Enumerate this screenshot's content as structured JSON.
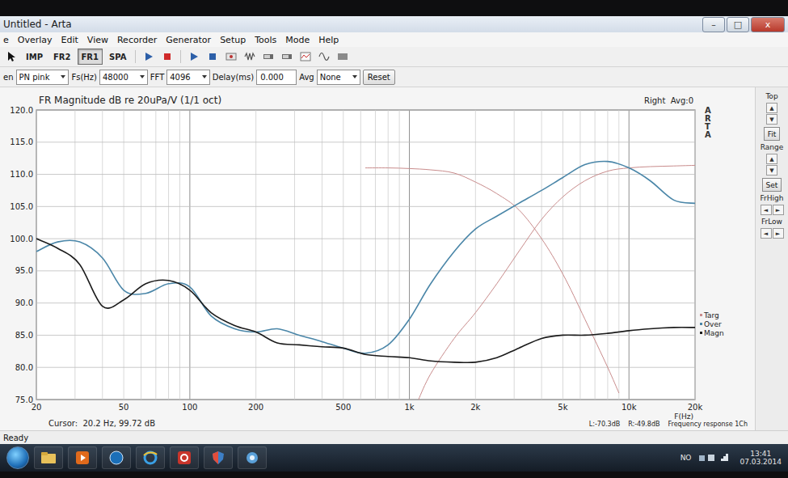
{
  "window": {
    "title": "Untitled - Arta",
    "controls": [
      "–",
      "□",
      "x"
    ]
  },
  "menu": [
    "e",
    "Overlay",
    "Edit",
    "View",
    "Recorder",
    "Generator",
    "Setup",
    "Tools",
    "Mode",
    "Help"
  ],
  "mode_buttons": [
    {
      "label": "IMP",
      "selected": false
    },
    {
      "label": "FR2",
      "selected": false
    },
    {
      "label": "FR1",
      "selected": true
    },
    {
      "label": "SPA",
      "selected": false
    }
  ],
  "generator_bar": [
    {
      "kind": "label",
      "text": "en"
    },
    {
      "kind": "select",
      "text": "PN pink"
    },
    {
      "kind": "label",
      "text": "Fs(Hz)"
    },
    {
      "kind": "select",
      "text": "48000"
    },
    {
      "kind": "label",
      "text": "FFT"
    },
    {
      "kind": "select",
      "text": "4096"
    },
    {
      "kind": "label",
      "text": "Delay(ms)"
    },
    {
      "kind": "input",
      "text": "0.000"
    },
    {
      "kind": "label",
      "text": "Avg"
    },
    {
      "kind": "select",
      "text": "None"
    },
    {
      "kind": "button",
      "text": "Reset"
    }
  ],
  "chart": {
    "title": "FR Magnitude dB re 20uPa/V (1/1 oct)",
    "channel": "Right  Avg:0",
    "watermark": "ARTA",
    "y_ticks": [
      "120.0",
      "115.0",
      "110.0",
      "105.0",
      "100.0",
      "95.0",
      "90.0",
      "85.0",
      "80.0",
      "75.0"
    ],
    "x_ticks": [
      "20",
      "50",
      "100",
      "200",
      "500",
      "1k",
      "2k",
      "5k",
      "10k",
      "20k"
    ],
    "x_axis_label": "F(Hz)",
    "cursor": "Cursor:  20.2 Hz, 99.72 dB",
    "readouts": [
      "L:-70.3dB",
      "R:-49.8dB",
      "Frequency response 1Ch"
    ],
    "series": [
      {
        "name": "Targ",
        "color": "#c98c8c",
        "curves": [
          {
            "frequencies": [
              1100,
              1250,
              1600,
              2000,
              2500,
              3150,
              4000,
              5000,
              6300,
              8000,
              10000,
              12500,
              16000,
              20000
            ],
            "values": [
              75,
              79,
              84.5,
              88.5,
              93,
              98,
              103,
              106.5,
              109,
              110.5,
              111,
              111.2,
              111.3,
              111.4
            ]
          },
          {
            "frequencies": [
              630,
              800,
              1000,
              1250,
              1600,
              2000,
              2500,
              3150,
              4000,
              5000,
              6300,
              8000,
              9000
            ],
            "values": [
              111,
              111,
              110.9,
              110.7,
              110.2,
              108.8,
              107,
              104.5,
              100,
              94.5,
              87.5,
              80,
              76
            ]
          }
        ]
      },
      {
        "name": "Over",
        "color": "#4a86a8",
        "curves": [
          {
            "frequencies": [
              20,
              25,
              31.5,
              40,
              50,
              63,
              80,
              100,
              125,
              160,
              200,
              250,
              315,
              400,
              500,
              630,
              800,
              1000,
              1250,
              1600,
              2000,
              2500,
              3150,
              4000,
              5000,
              6300,
              8000,
              10000,
              12500,
              16000,
              20000
            ],
            "values": [
              98,
              99.5,
              99.5,
              97,
              92,
              91.5,
              93,
              92.5,
              88,
              86,
              85.5,
              86,
              85,
              84,
              83,
              82.2,
              83.5,
              87.5,
              93,
              98,
              101.5,
              103.5,
              105.5,
              107.5,
              109.5,
              111.5,
              112,
              111,
              109,
              106,
              105.5
            ]
          }
        ]
      },
      {
        "name": "Magn",
        "color": "#1b1b1b",
        "curves": [
          {
            "frequencies": [
              20,
              25,
              31.5,
              40,
              50,
              63,
              80,
              100,
              125,
              160,
              200,
              250,
              315,
              400,
              500,
              630,
              800,
              1000,
              1250,
              1600,
              2000,
              2500,
              3150,
              4000,
              5000,
              6300,
              8000,
              10000,
              12500,
              16000,
              20000
            ],
            "values": [
              100,
              98.5,
              96,
              89.5,
              90.5,
              93,
              93.5,
              92,
              88.5,
              86.5,
              85.5,
              83.8,
              83.5,
              83.2,
              83,
              82,
              81.7,
              81.5,
              81,
              80.8,
              80.8,
              81.5,
              83,
              84.5,
              85,
              85,
              85.3,
              85.7,
              86,
              86.2,
              86.2
            ]
          }
        ]
      }
    ]
  },
  "side_panel": [
    {
      "kind": "label",
      "text": "Top"
    },
    {
      "kind": "arrows",
      "glyphs": [
        "▲",
        "▼"
      ]
    },
    {
      "kind": "button",
      "text": "Fit"
    },
    {
      "kind": "label",
      "text": "Range"
    },
    {
      "kind": "arrows",
      "glyphs": [
        "▲",
        "▼"
      ]
    },
    {
      "kind": "button",
      "text": "Set"
    },
    {
      "kind": "label",
      "text": "FrHigh"
    },
    {
      "kind": "arrows",
      "glyphs": [
        "◄",
        "►"
      ]
    },
    {
      "kind": "label",
      "text": "FrLow"
    },
    {
      "kind": "arrows",
      "glyphs": [
        "◄",
        "►"
      ]
    }
  ],
  "status_bar": "Ready",
  "taskbar": {
    "tray": "NO",
    "time": "13:41",
    "date": "07.03.2014"
  }
}
